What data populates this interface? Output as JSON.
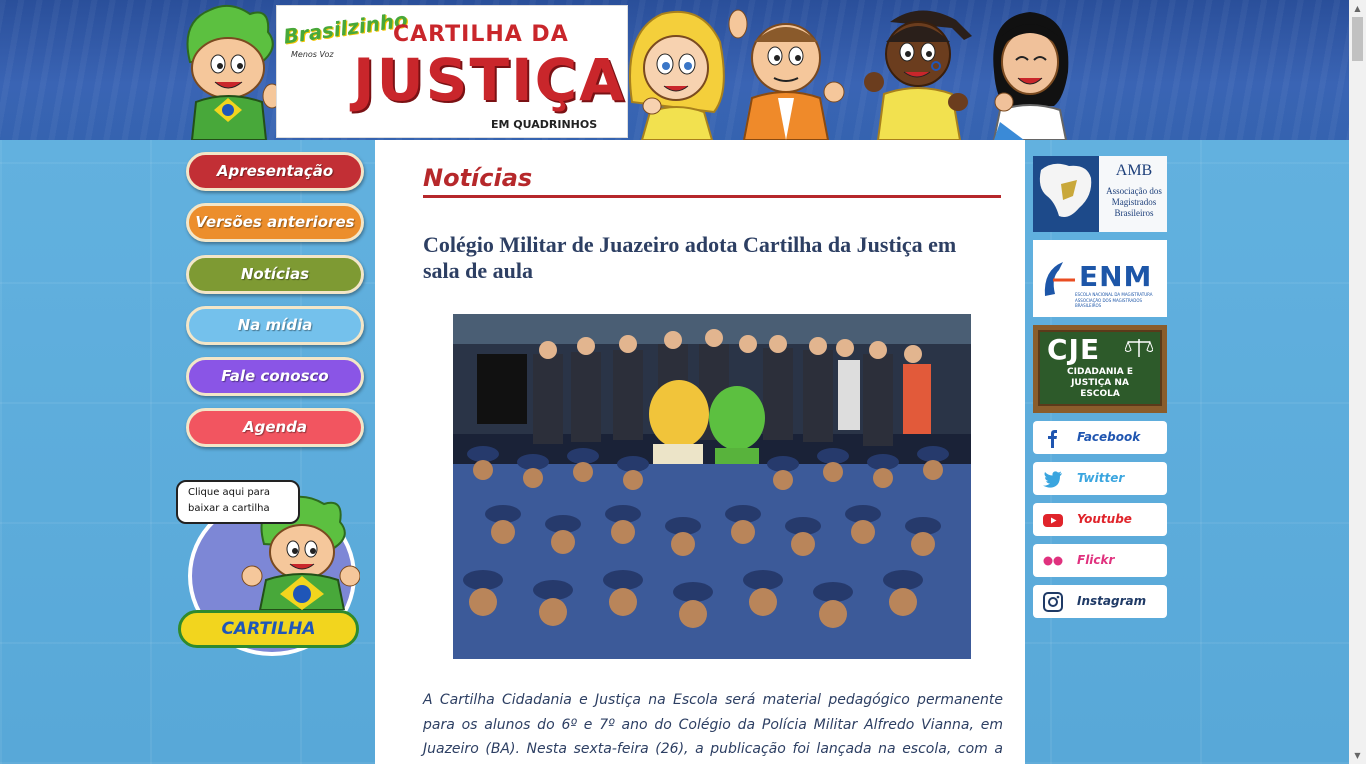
{
  "header": {
    "brand": "Brasilzinho",
    "brand_sub": "Menos Voz",
    "logo_line1": "CARTILHA DA",
    "logo_line2": "JUSTIÇA",
    "logo_line3": "EM QUADRINHOS"
  },
  "menu": {
    "items": [
      {
        "label": "Apresentação",
        "color": "#c22f35"
      },
      {
        "label": "Versões anteriores",
        "color": "#ec8e2c"
      },
      {
        "label": "Notícias",
        "color": "#7e9a33"
      },
      {
        "label": "Na mídia",
        "color": "#74c1ec"
      },
      {
        "label": "Fale conosco",
        "color": "#8a55e6"
      },
      {
        "label": "Agenda",
        "color": "#f25560"
      }
    ]
  },
  "download": {
    "speech": "Clique aqui para baixar a cartilha",
    "button": "CARTILHA"
  },
  "main": {
    "section_title": "Notícias",
    "article_title": "Colégio Militar de Juazeiro adota Cartilha da Justiça em sala de aula",
    "article_body": "A Cartilha Cidadania e Justiça na Escola será material pedagógico permanente para os alunos do 6º e 7º ano do Colégio da Polícia Militar Alfredo Vianna, em Juazeiro (BA). Nesta sexta-feira (26), a publicação foi lançada na escola, com a presença de"
  },
  "partners": {
    "amb": {
      "abbr": "AMB",
      "line1": "Associação dos",
      "line2": "Magistrados",
      "line3": "Brasileiros"
    },
    "enm": {
      "abbr": "ENM",
      "sub": "ESCOLA NACIONAL DA MAGISTRATURA",
      "sub2": "ASSOCIAÇÃO DOS MAGISTRADOS BRASILEIROS"
    },
    "cje": {
      "abbr": "CJE",
      "line1": "CIDADANIA E",
      "line2": "JUSTIÇA NA",
      "line3": "ESCOLA"
    }
  },
  "social": [
    {
      "label": "Facebook",
      "icon": "facebook-icon",
      "color": "#1f55b0"
    },
    {
      "label": "Twitter",
      "icon": "twitter-icon",
      "color": "#3aa5df"
    },
    {
      "label": "Youtube",
      "icon": "youtube-icon",
      "color": "#e0242b"
    },
    {
      "label": "Flickr",
      "icon": "flickr-icon",
      "color": "#e0317e"
    },
    {
      "label": "Instagram",
      "icon": "instagram-icon",
      "color": "#1f3a66"
    }
  ]
}
